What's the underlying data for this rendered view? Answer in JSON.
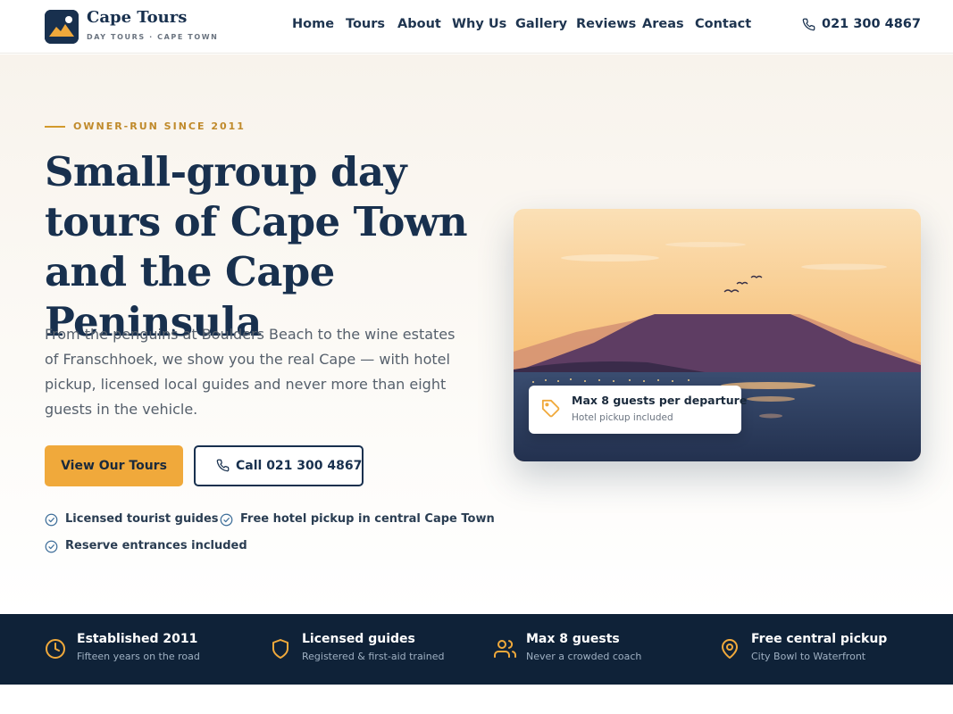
{
  "brand": {
    "name": "Cape Tours",
    "tagline": "DAY TOURS · CAPE TOWN"
  },
  "nav": {
    "links": [
      "Home",
      "Tours",
      "About",
      "Why Us",
      "Gallery",
      "Reviews",
      "Areas",
      "Contact"
    ],
    "phone": "021 300 4867"
  },
  "hero": {
    "eyebrow": "OWNER-RUN SINCE 2011",
    "headline": "Small-group day tours of Cape Town and the Cape Peninsula",
    "intro": "From the penguins at Boulders Beach to the wine estates of Franschhoek, we show you the real Cape — with hotel pickup, licensed local guides and never more than eight guests in the vehicle.",
    "primary_cta": "View Our Tours",
    "secondary_cta": "Call 021 300 4867",
    "checks": [
      "Licensed tourist guides",
      "Free hotel pickup in central Cape Town",
      "Reserve entrances included"
    ]
  },
  "card": {
    "badge_title": "Max 8 guests per departure",
    "badge_sub": "Hotel pickup included"
  },
  "features": [
    {
      "icon": "clock-icon",
      "title": "Established 2011",
      "sub": "Fifteen years on the road"
    },
    {
      "icon": "shield-icon",
      "title": "Licensed guides",
      "sub": "Registered & first-aid trained"
    },
    {
      "icon": "users-icon",
      "title": "Max 8 guests",
      "sub": "Never a crowded coach"
    },
    {
      "icon": "map-pin-icon",
      "title": "Free central pickup",
      "sub": "City Bowl to Waterfront"
    }
  ],
  "colors": {
    "navy": "#18304e",
    "accent": "#f0a93b",
    "strip": "#0f2238"
  }
}
